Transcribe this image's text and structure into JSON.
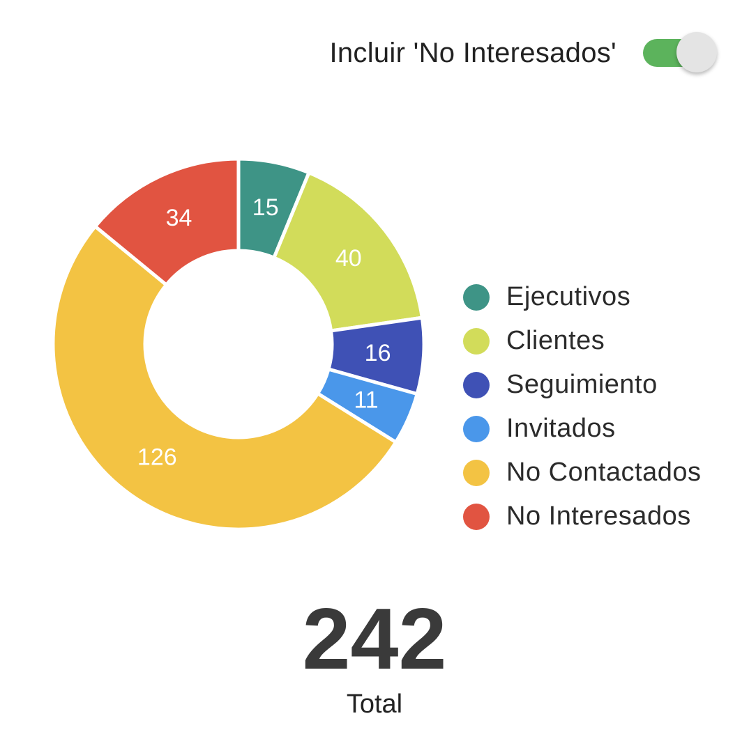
{
  "toggle": {
    "label": "Incluir 'No Interesados'",
    "on": true,
    "track_color": "#5cb35c"
  },
  "chart_data": {
    "type": "pie",
    "variant": "donut",
    "legend_position": "right",
    "categories": [
      "Ejecutivos",
      "Clientes",
      "Seguimiento",
      "Invitados",
      "No Contactados",
      "No Interesados"
    ],
    "values": [
      15,
      40,
      16,
      11,
      126,
      34
    ],
    "colors": [
      "#3e9486",
      "#d2dc5a",
      "#3f51b5",
      "#4a97ea",
      "#f3c343",
      "#e15441"
    ]
  },
  "total": {
    "value": "242",
    "label": "Total"
  }
}
